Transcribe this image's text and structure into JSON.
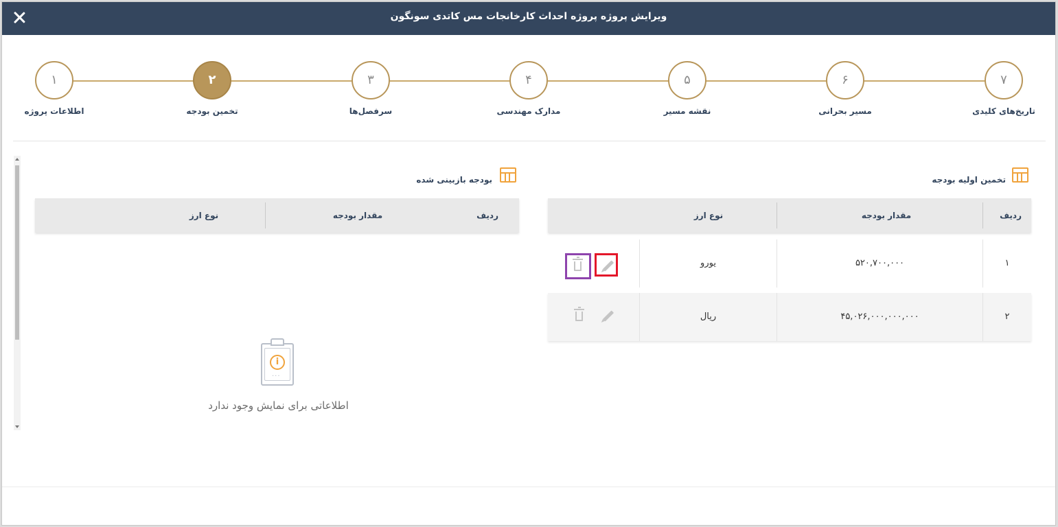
{
  "header": {
    "title": "ویرایش پروژه پروژه احداث کارخانجات مس کاتدی سونگون"
  },
  "steps": [
    {
      "number": "۱",
      "label": "اطلاعات پروژه",
      "active": false
    },
    {
      "number": "۲",
      "label": "تخمین بودجه",
      "active": true
    },
    {
      "number": "۳",
      "label": "سرفصل‌ها",
      "active": false
    },
    {
      "number": "۴",
      "label": "مدارک مهندسی",
      "active": false
    },
    {
      "number": "۵",
      "label": "نقشه مسیر",
      "active": false
    },
    {
      "number": "۶",
      "label": "مسیر بحرانی",
      "active": false
    },
    {
      "number": "۷",
      "label": "تاریخ‌های کلیدی",
      "active": false
    }
  ],
  "initial_budget": {
    "title": "تخمین اولیه بودجه",
    "columns": {
      "row": "ردیف",
      "amount": "مقدار بودجه",
      "currency": "نوع ارز"
    },
    "rows": [
      {
        "row": "۱",
        "amount": "۵۲۰,۷۰۰,۰۰۰",
        "currency": "یورو"
      },
      {
        "row": "۲",
        "amount": "۴۵,۰۲۶,۰۰۰,۰۰۰,۰۰۰",
        "currency": "ریال"
      }
    ]
  },
  "revised_budget": {
    "title": "بودجه بازبینی شده",
    "columns": {
      "row": "ردیف",
      "amount": "مقدار بودجه",
      "currency": "نوع ارز"
    },
    "empty_message": "اطلاعاتی برای نمایش وجود ندارد"
  },
  "colors": {
    "header": "#34465e",
    "accent_gold": "#b8965a",
    "icon_orange": "#f0a33c",
    "highlight_red": "#e4172a",
    "highlight_purple": "#8e44ad"
  },
  "icons": [
    "close-icon",
    "table-icon",
    "pencil-icon",
    "trash-icon",
    "clipboard-info-icon"
  ]
}
